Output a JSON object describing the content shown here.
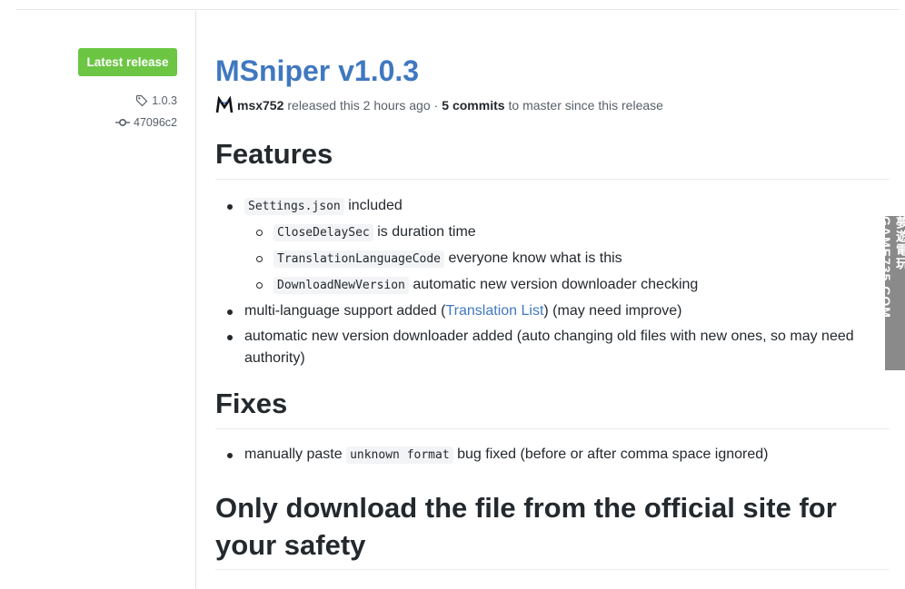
{
  "sidebar": {
    "latest_label": "Latest release",
    "tag": "1.0.3",
    "commit": "47096c2",
    "tag_icon": "tag-icon",
    "commit_icon": "git-commit-icon"
  },
  "release": {
    "title": "MSniper v1.0.3",
    "author": "msx752",
    "released_text": "released this 2 hours ago",
    "separator": "·",
    "commits_label": "5 commits",
    "commits_suffix": "to master since this release"
  },
  "sections": {
    "features": {
      "heading": "Features",
      "item1": {
        "code": "Settings.json",
        "text": "included"
      },
      "sub1": {
        "code": "CloseDelaySec",
        "text": "is duration time"
      },
      "sub2": {
        "code": "TranslationLanguageCode",
        "text": "everyone know what is this"
      },
      "sub3": {
        "code": "DownloadNewVersion",
        "text": "automatic new version downloader checking"
      },
      "item2": {
        "pre": "multi-language support added (",
        "link": "Translation List",
        "post": ") (may need improve)"
      },
      "item3": {
        "text": "automatic new version downloader added (auto changing old files with new ones, so may need authority)"
      }
    },
    "fixes": {
      "heading": "Fixes",
      "item1": {
        "pre": "manually paste",
        "code": "unknown format",
        "post": "bug fixed (before or after comma space ignored)"
      }
    },
    "safety": {
      "heading": "Only download the file from the official site for your safety"
    }
  },
  "watermark": {
    "text": "夢遊電玩 GAME735.COM"
  },
  "colors": {
    "accent": "#4078c0",
    "badge": "#6cc644",
    "text": "#24292e",
    "muted": "#586069"
  }
}
